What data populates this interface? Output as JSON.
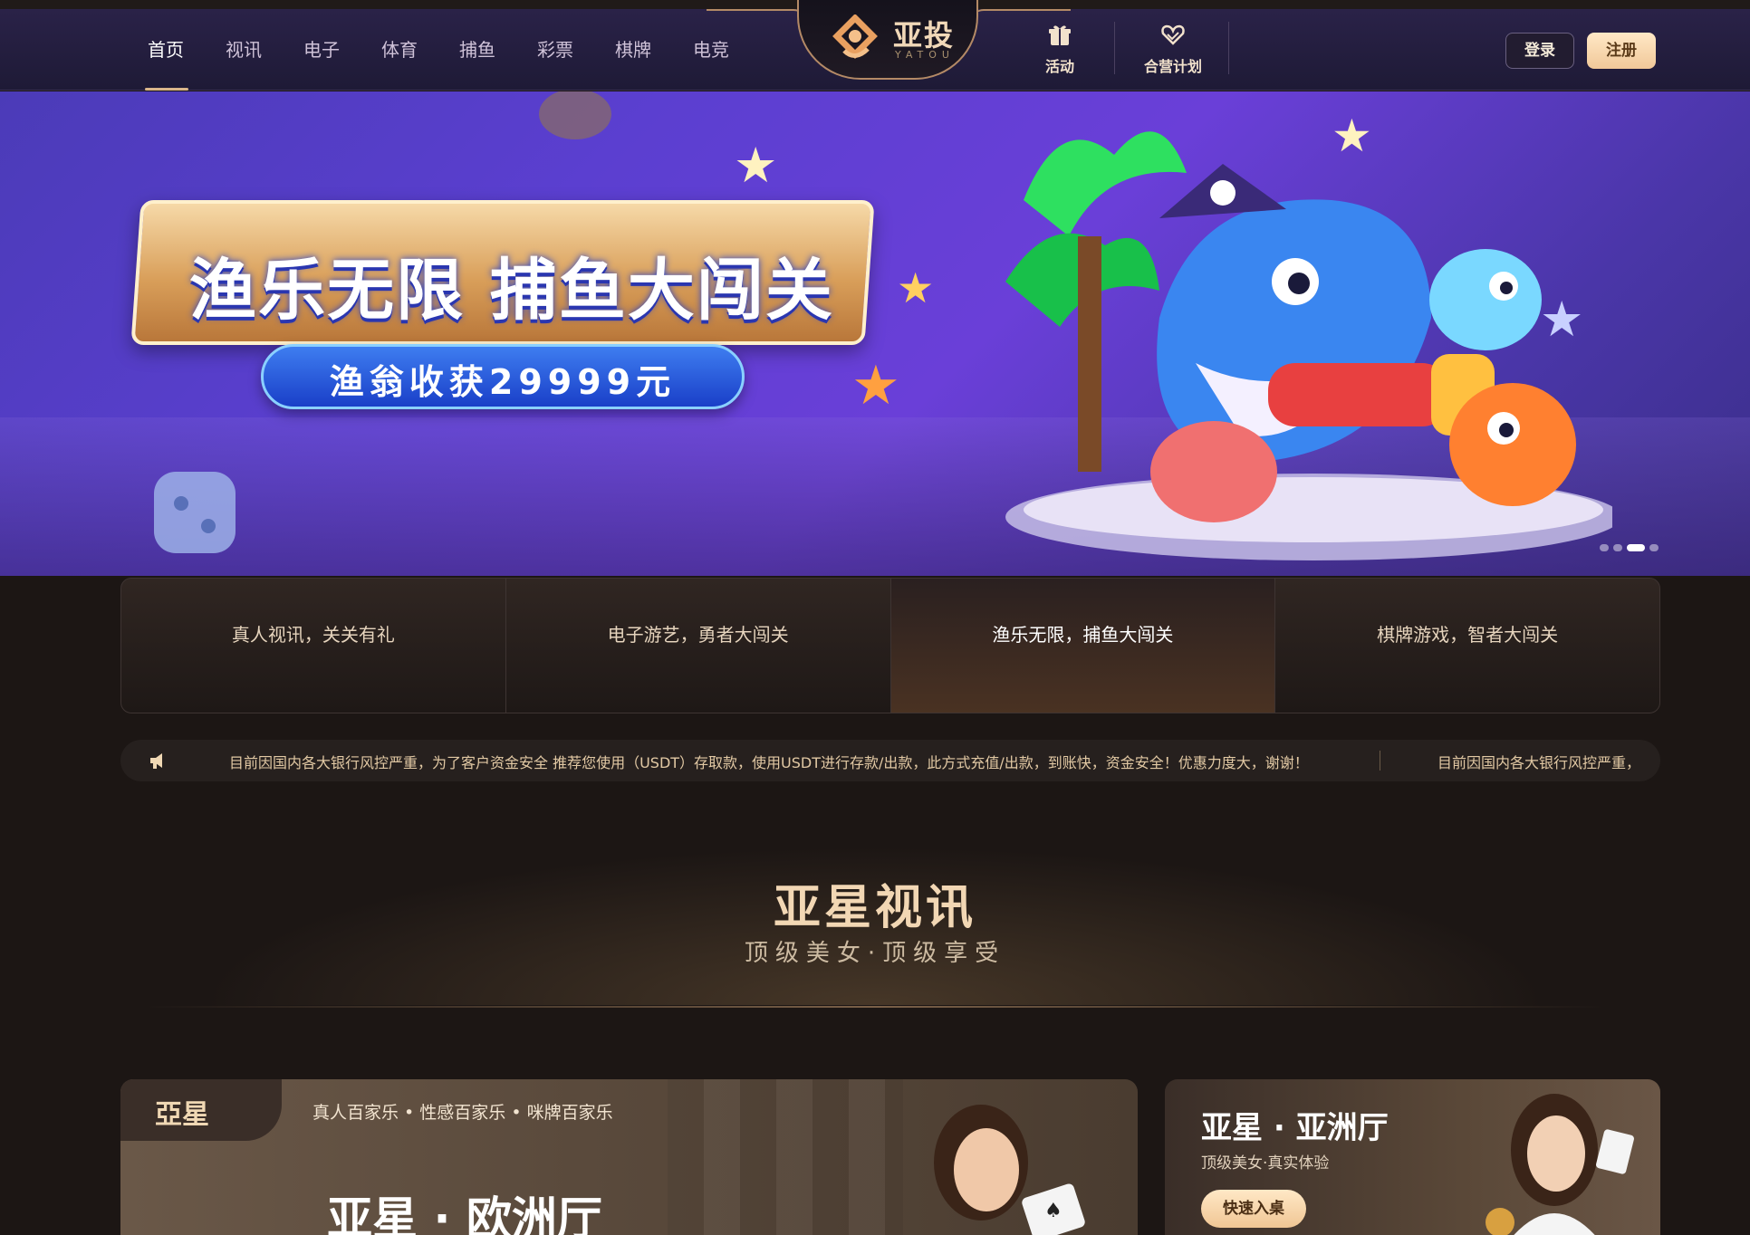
{
  "header": {
    "nav": [
      "首页",
      "视讯",
      "电子",
      "体育",
      "捕鱼",
      "彩票",
      "棋牌",
      "电竞"
    ],
    "active_nav": "首页",
    "logo_text": "亚投",
    "logo_sub": "YATOU",
    "features": {
      "activity": "活动",
      "partner_plan": "合营计划"
    },
    "login_label": "登录",
    "register_label": "注册"
  },
  "banner": {
    "title": "渔乐无限 捕鱼大闯关",
    "subtitle": "渔翁收获29999元",
    "slides_total": 4,
    "active_slide": 3
  },
  "categories": [
    "真人视讯，关关有礼",
    "电子游艺，勇者大闯关",
    "渔乐无限，捕鱼大闯关",
    "棋牌游戏，智者大闯关"
  ],
  "active_category": "渔乐无限，捕鱼大闯关",
  "notice": {
    "text": "目前因国内各大银行风控严重，为了客户资金安全 推荐您使用（USDT）存取款，使用USDT进行存款/出款，此方式充值/出款，到账快，资金安全！优惠力度大，谢谢！",
    "text_repeat": "目前因国内各大银行风控严重，"
  },
  "section": {
    "title": "亚星视讯",
    "subtitle": "顶级美女·顶级享受"
  },
  "card_europe": {
    "logo": "亞星",
    "tags": "真人百家乐  •  性感百家乐  •  咪牌百家乐",
    "title": "亚星 · 欧洲厅"
  },
  "card_asia": {
    "title": "亚星 · 亚洲厅",
    "subtitle": "顶级美女·真实体验",
    "button": "快速入桌"
  },
  "colors": {
    "header_bg": "#221c3c",
    "accent_gold": "#d9b58a",
    "page_bg": "#1c1614",
    "banner_purple": "#5b3fd0"
  }
}
